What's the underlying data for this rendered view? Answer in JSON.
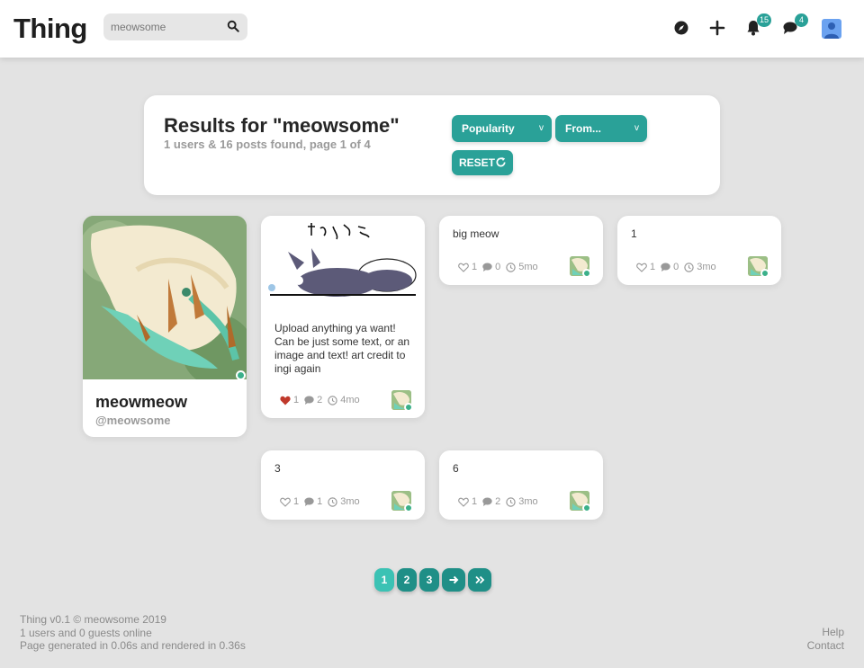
{
  "header": {
    "logo": "Thing",
    "search": {
      "value": "meowsome",
      "icon": "search-icon"
    },
    "nav": {
      "explore_icon": "compass-icon",
      "create_icon": "plus-icon",
      "notifications_icon": "bell-icon",
      "notifications_count": "15",
      "messages_icon": "chat-icon",
      "messages_count": "4",
      "avatar_icon": "user-icon"
    }
  },
  "results": {
    "title": "Results for \"meowsome\"",
    "subtitle": "1 users & 16 posts found, page 1 of 4",
    "sort_selected": "Popularity",
    "time_selected": "From...",
    "caret": "v",
    "reset_label": "RESET"
  },
  "user": {
    "name": "meowmeow",
    "handle": "@meowsome",
    "online": true
  },
  "posts": [
    {
      "text": "Upload anything ya want! Can be just some text, or an image and text! art credit to ingi again",
      "likes": "1",
      "liked": true,
      "comments": "2",
      "age": "4mo",
      "image_caption": "すやんま"
    },
    {
      "text": "big meow",
      "likes": "1",
      "liked": false,
      "comments": "0",
      "age": "5mo"
    },
    {
      "text": "1",
      "likes": "1",
      "liked": false,
      "comments": "0",
      "age": "3mo"
    },
    {
      "text": "3",
      "likes": "1",
      "liked": false,
      "comments": "1",
      "age": "3mo"
    },
    {
      "text": "6",
      "likes": "1",
      "liked": false,
      "comments": "2",
      "age": "3mo"
    }
  ],
  "pagination": {
    "pages": [
      "1",
      "2",
      "3"
    ],
    "current": "1",
    "next_icon": "arrow-right-icon",
    "last_icon": "double-chevron-right-icon"
  },
  "footer": {
    "version": "Thing v0.1 © meowsome 2019",
    "online": "1 users and 0 guests online",
    "timing": "Page generated in 0.06s and rendered in 0.36s",
    "help": "Help",
    "contact": "Contact"
  },
  "colors": {
    "accent": "#2aa198",
    "accent_dark": "#1f8f87",
    "accent_light": "#3bc2b4",
    "liked": "#c0392b",
    "online": "#3bb08a"
  }
}
